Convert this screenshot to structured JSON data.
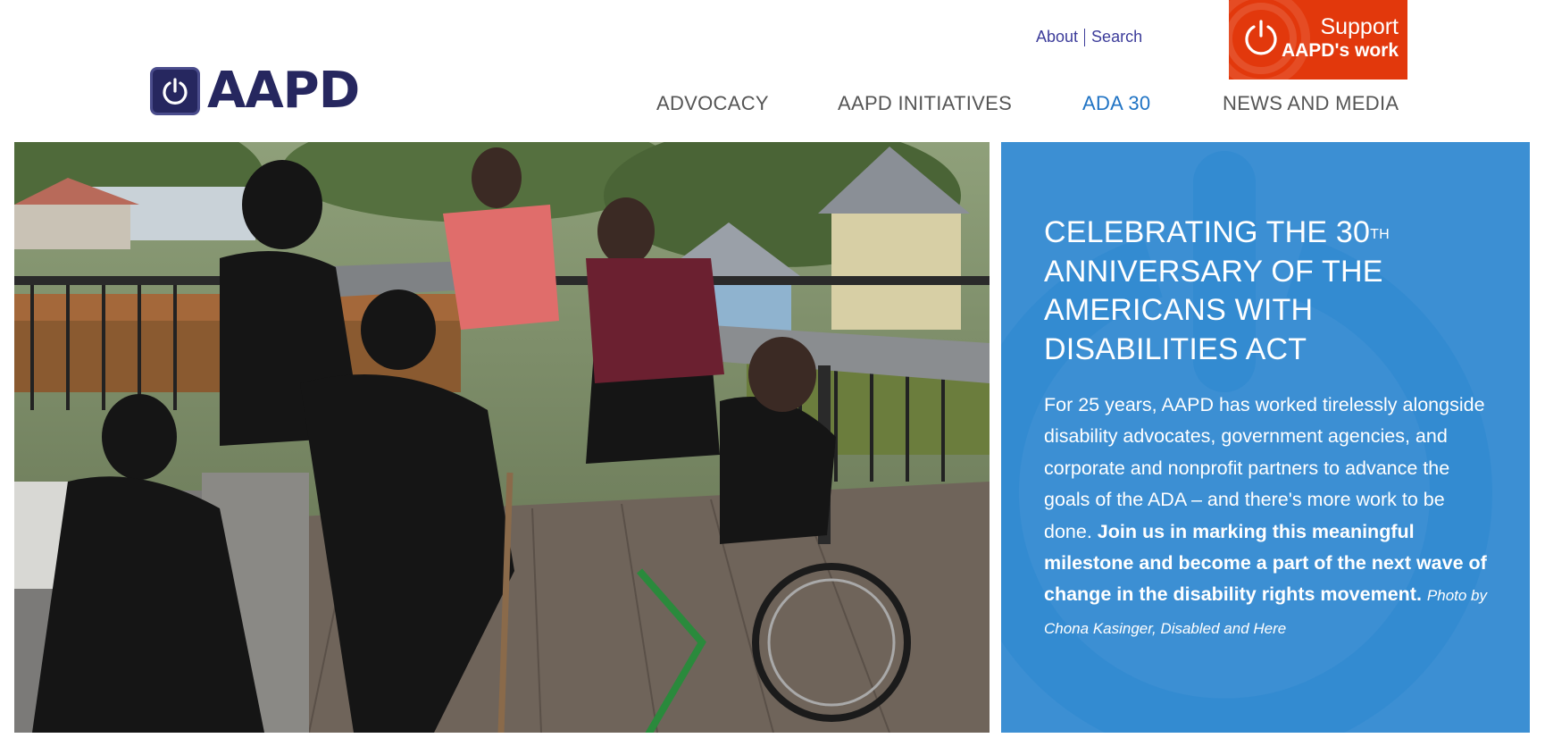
{
  "brand": {
    "name": "AAPD",
    "color": "#26275f",
    "logo_icon": "power-icon"
  },
  "utility_links": [
    {
      "label": "About"
    },
    {
      "label": "Search"
    }
  ],
  "support": {
    "line1": "Support",
    "line2": "AAPD's work",
    "color": "#e2380c",
    "icon": "power-icon"
  },
  "nav": [
    {
      "label": "ADVOCACY"
    },
    {
      "label": "AAPD INITIATIVES"
    },
    {
      "label": "ADA 30",
      "active": true
    },
    {
      "label": "NEWS AND MEDIA"
    }
  ],
  "hero": {
    "panel_color": "#3c8fd3",
    "heading_pre": "CELEBRATING THE 30",
    "heading_sup": "TH",
    "heading_post": "ANNIVERSARY OF THE AMERICANS WITH DISABILITIES ACT",
    "body": "For 25 years, AAPD has worked tirelessly alongside disability advocates, government agencies, and corporate and nonprofit partners to advance the goals of the ADA – and there's more work to be done.",
    "body_bold": "Join us in marking this meaningful milestone and become a part of the next wave of change in the disability rights movement.",
    "credit": "Photo by Chona Kasinger, Disabled and Here"
  }
}
